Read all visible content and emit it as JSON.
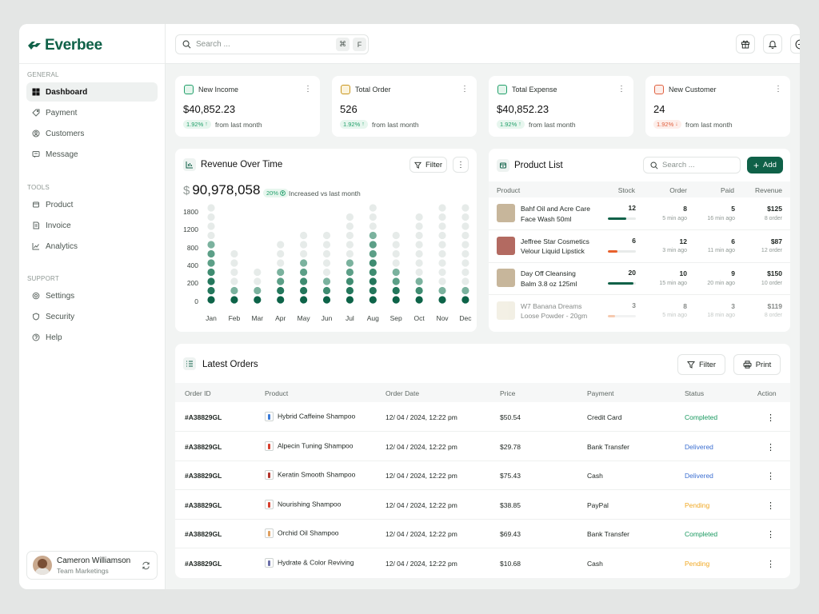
{
  "brand": "Everbee",
  "sidebar": {
    "general_label": "GENERAL",
    "tools_label": "TOOLS",
    "support_label": "SUPPORT",
    "general": [
      {
        "label": "Dashboard",
        "icon": "grid-icon"
      },
      {
        "label": "Payment",
        "icon": "tag-icon"
      },
      {
        "label": "Customers",
        "icon": "user-circle-icon"
      },
      {
        "label": "Message",
        "icon": "message-icon"
      }
    ],
    "tools": [
      {
        "label": "Product",
        "icon": "box-icon"
      },
      {
        "label": "Invoice",
        "icon": "invoice-icon"
      },
      {
        "label": "Analytics",
        "icon": "chart-icon"
      }
    ],
    "support": [
      {
        "label": "Settings",
        "icon": "gear-icon"
      },
      {
        "label": "Security",
        "icon": "shield-icon"
      },
      {
        "label": "Help",
        "icon": "help-icon"
      }
    ],
    "user": {
      "name": "Cameron Williamson",
      "role": "Team Marketings"
    }
  },
  "topbar": {
    "search_placeholder": "Search ...",
    "kbd1": "⌘",
    "kbd2": "F"
  },
  "stats": [
    {
      "title": "New Income",
      "value": "$40,852.23",
      "pct": "1.92%",
      "trend": "up",
      "note": "from last month"
    },
    {
      "title": "Total Order",
      "value": "526",
      "pct": "1.92%",
      "trend": "up",
      "note": "from last month"
    },
    {
      "title": "Total Expense",
      "value": "$40,852.23",
      "pct": "1.92%",
      "trend": "up",
      "note": "from last month"
    },
    {
      "title": "New Customer",
      "value": "24",
      "pct": "1.92%",
      "trend": "down",
      "note": "from last month"
    }
  ],
  "revenue": {
    "title": "Revenue Over Time",
    "filter_label": "Filter",
    "currency": "$",
    "total": "90,978,058",
    "pct": "20%",
    "note": "Increased vs last month"
  },
  "chart_data": {
    "type": "bar",
    "style": "dot-matrix",
    "categories": [
      "Jan",
      "Feb",
      "Mar",
      "Apr",
      "May",
      "Jun",
      "Jul",
      "Aug",
      "Sep",
      "Oct",
      "Nov",
      "Dec"
    ],
    "yticks": [
      "1800",
      "1200",
      "800",
      "400",
      "200",
      "0"
    ],
    "max_dots": 11,
    "series": [
      {
        "values": [
          11,
          6,
          4,
          7,
          8,
          8,
          10,
          11,
          8,
          10,
          11,
          11
        ]
      },
      {
        "values": [
          7,
          2,
          2,
          4,
          5,
          3,
          5,
          8,
          4,
          3,
          2,
          2
        ]
      }
    ]
  },
  "product_list": {
    "title": "Product List",
    "search_placeholder": "Search ...",
    "add_label": "Add",
    "headers": [
      "Product",
      "Stock",
      "Order",
      "Paid",
      "Revenue"
    ],
    "rows": [
      {
        "name1": "Bahf Oil and Acre Care",
        "name2": "Face Wash 50ml",
        "stock": "12",
        "stock_pct": 0.65,
        "bar_color": "#0f6148",
        "order": "8",
        "order_sub": "5 min ago",
        "paid": "5",
        "paid_sub": "16 min ago",
        "revenue": "$125",
        "revenue_sub": "8 order",
        "thumb": "#c7b69b",
        "dim": false
      },
      {
        "name1": "Jeffree Star Cosmetics",
        "name2": "Velour Liquid Lipstick",
        "stock": "6",
        "stock_pct": 0.35,
        "bar_color": "#e8602c",
        "order": "12",
        "order_sub": "3 min ago",
        "paid": "6",
        "paid_sub": "11 min ago",
        "revenue": "$87",
        "revenue_sub": "12 order",
        "thumb": "#b36a61",
        "dim": false
      },
      {
        "name1": "Day Off Cleansing",
        "name2": "Balm 3.8 oz 125ml",
        "stock": "20",
        "stock_pct": 0.9,
        "bar_color": "#0f6148",
        "order": "10",
        "order_sub": "15 min ago",
        "paid": "9",
        "paid_sub": "20 min ago",
        "revenue": "$150",
        "revenue_sub": "10 order",
        "thumb": "#c7b69b",
        "dim": false
      },
      {
        "name1": "W7 Banana Dreams",
        "name2": "Loose Powder - 20gm",
        "stock": "3",
        "stock_pct": 0.25,
        "bar_color": "#f0a070",
        "order": "8",
        "order_sub": "5 min ago",
        "paid": "3",
        "paid_sub": "18 min ago",
        "revenue": "$119",
        "revenue_sub": "8 order",
        "thumb": "#e9e3cf",
        "dim": true
      }
    ]
  },
  "orders": {
    "title": "Latest Orders",
    "filter_label": "Filter",
    "print_label": "Print",
    "headers": [
      "Order ID",
      "Product",
      "Order Date",
      "Price",
      "Payment",
      "Status",
      "Action"
    ],
    "rows": [
      {
        "id": "#A38829GL",
        "product": "Hybrid Caffeine Shampoo",
        "date": "12/ 04 / 2024, 12:22 pm",
        "price": "$50.54",
        "payment": "Credit Card",
        "status": "Completed",
        "color": "#1a9960",
        "icon": "#3b7bd8"
      },
      {
        "id": "#A38829GL",
        "product": "Alpecin Tuning Shampoo",
        "date": "12/ 04 / 2024, 12:22 pm",
        "price": "$29.78",
        "payment": "Bank Transfer",
        "status": "Delivered",
        "color": "#3c6fd1",
        "icon": "#d8402f"
      },
      {
        "id": "#A38829GL",
        "product": "Keratin Smooth Shampoo",
        "date": "12/ 04 / 2024, 12:22 pm",
        "price": "$75.43",
        "payment": "Cash",
        "status": "Delivered",
        "color": "#3c6fd1",
        "icon": "#b3342c"
      },
      {
        "id": "#A38829GL",
        "product": "Nourishing Shampoo",
        "date": "12/ 04 / 2024, 12:22 pm",
        "price": "$38.85",
        "payment": "PayPal",
        "status": "Pending",
        "color": "#f0a823",
        "icon": "#d8402f"
      },
      {
        "id": "#A38829GL",
        "product": "Orchid Oil Shampoo",
        "date": "12/ 04 / 2024, 12:22 pm",
        "price": "$69.43",
        "payment": "Bank Transfer",
        "status": "Completed",
        "color": "#1a9960",
        "icon": "#e0a060"
      },
      {
        "id": "#A38829GL",
        "product": "Hydrate & Color Reviving",
        "date": "12/ 04 / 2024, 12:22 pm",
        "price": "$10.68",
        "payment": "Cash",
        "status": "Pending",
        "color": "#f0a823",
        "icon": "#6b6fa8"
      }
    ]
  }
}
